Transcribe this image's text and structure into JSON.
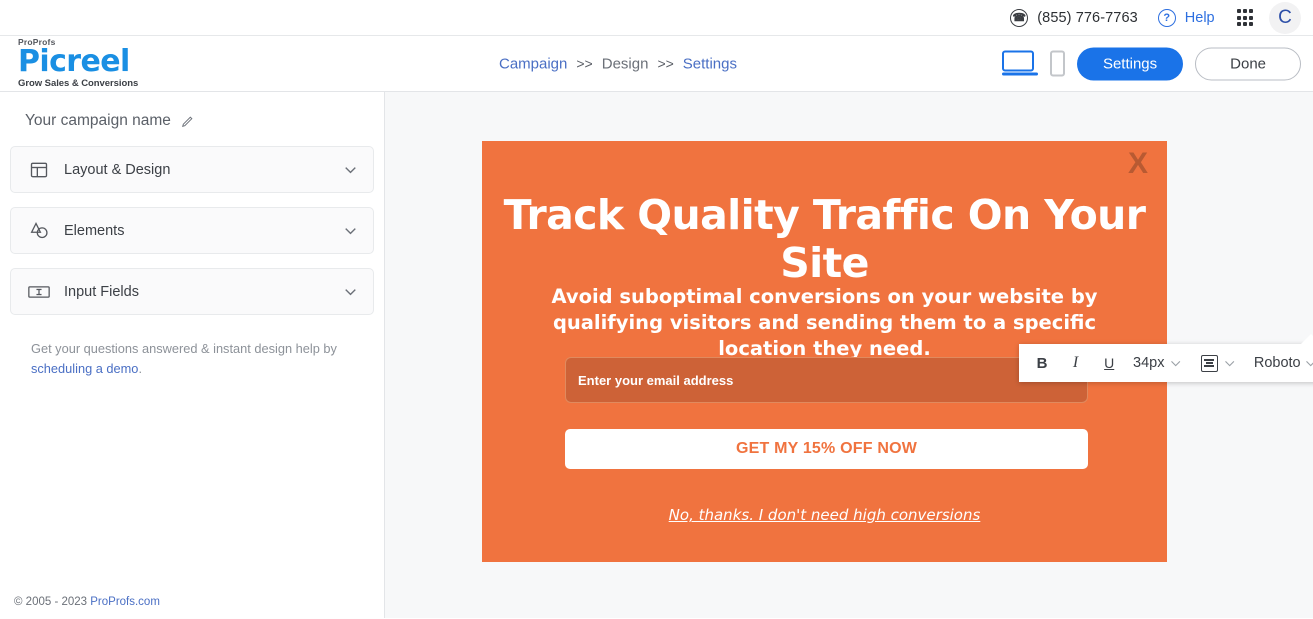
{
  "utility_bar": {
    "phone": "(855) 776-7763",
    "help_label": "Help",
    "phone_icon": "phone-circle-icon",
    "help_icon": "question-circle-icon",
    "apps_icon": "apps-grid-icon",
    "avatar_initial": "C"
  },
  "header": {
    "logo": {
      "pre": "ProProfs",
      "name": "Picreel",
      "tagline": "Grow Sales & Conversions",
      "brand_color": "#1a8fe3"
    },
    "breadcrumb": [
      {
        "label": "Campaign",
        "active": false
      },
      {
        "label": "Design",
        "active": true
      },
      {
        "label": "Settings",
        "active": false
      }
    ],
    "breadcrumb_separator": ">>",
    "desktop_icon": "desktop-preview-icon",
    "mobile_icon": "mobile-preview-icon",
    "settings_label": "Settings",
    "done_label": "Done",
    "accent_color": "#1a73e8"
  },
  "sidebar": {
    "campaign_name": "Your campaign name",
    "edit_icon": "pencil-edit-icon",
    "panels": [
      {
        "label": "Layout & Design",
        "icon": "layout-grid-icon"
      },
      {
        "label": "Elements",
        "icon": "shapes-icon"
      },
      {
        "label": "Input Fields",
        "icon": "input-field-icon"
      }
    ],
    "helper_text": "Get your questions answered & instant design help by ",
    "helper_link": "scheduling a demo",
    "helper_suffix": ".",
    "copyright": "© 2005 - 2023 ",
    "copyright_link": "ProProfs.com"
  },
  "toolbar": {
    "bold": "B",
    "italic": "I",
    "underline": "U",
    "font_size": "34px",
    "align_icon": "text-align-icon",
    "font_family": "Roboto",
    "text_color_icon": "text-color-icon",
    "highlight_icon": "text-highlight-icon",
    "image_icon": "insert-image-icon",
    "border_icon": "border-frame-icon",
    "reset_icon": "reset-style-icon",
    "delete_icon": "trash-icon",
    "chevron_icon": "chevron-down-icon"
  },
  "popup": {
    "background_color": "#f0733f",
    "close_label": "X",
    "title": "Track Quality Traffic On Your Site",
    "subtitle": "Avoid suboptimal conversions on your website by qualifying visitors and sending them to a specific location they need.",
    "email_placeholder": "Enter your email address",
    "cta_label": "GET MY 15% OFF NOW",
    "decline_label": "No, thanks. I don't need high conversions"
  }
}
